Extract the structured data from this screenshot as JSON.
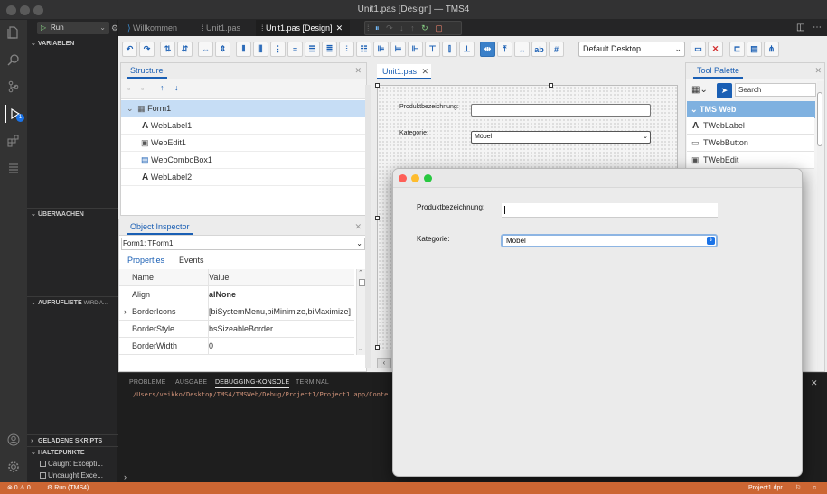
{
  "window": {
    "title": "Unit1.pas [Design] — TMS4"
  },
  "run": {
    "config": "Run"
  },
  "sidebar": {
    "variables": "VARIABLEN",
    "watch": "ÜBERWACHEN",
    "callstack": "AUFRUFLISTE",
    "callstack_status": "WIRD A...",
    "scripts": "GELADENE SKRIPTS",
    "breakpoints": "HALTEPUNKTE",
    "bp1": "Caught Excepti...",
    "bp2": "Uncaught Exce..."
  },
  "activity": {
    "debug_badge": "1"
  },
  "tabs": [
    {
      "label": "Willkommen"
    },
    {
      "label": "Unit1.pas"
    },
    {
      "label": "Unit1.pas [Design]"
    }
  ],
  "toolbar": {
    "device": "Default Desktop"
  },
  "structure": {
    "title": "Structure",
    "items": [
      {
        "label": "Form1",
        "icon": "form-icon"
      },
      {
        "label": "WebLabel1",
        "icon": "label-icon"
      },
      {
        "label": "WebEdit1",
        "icon": "edit-icon"
      },
      {
        "label": "WebComboBox1",
        "icon": "combobox-icon"
      },
      {
        "label": "WebLabel2",
        "icon": "label-icon"
      }
    ]
  },
  "inspector": {
    "title": "Object Inspector",
    "selected": "Form1: TForm1",
    "tab_properties": "Properties",
    "tab_events": "Events",
    "col_name": "Name",
    "col_value": "Value",
    "rows": [
      {
        "name": "Align",
        "value": "alNone",
        "expand": ""
      },
      {
        "name": "BorderIcons",
        "value": "[biSystemMenu,biMinimize,biMaximize]",
        "expand": "›"
      },
      {
        "name": "BorderStyle",
        "value": "bsSizeableBorder",
        "expand": ""
      },
      {
        "name": "BorderWidth",
        "value": "0",
        "expand": ""
      }
    ]
  },
  "designer": {
    "tab": "Unit1.pas",
    "label1": "Produktbezeichnung:",
    "label2": "Kategorie:",
    "combo_value": "Möbel"
  },
  "palette": {
    "title": "Tool Palette",
    "search_placeholder": "Search",
    "category": "TMS Web",
    "items": [
      "TWebLabel",
      "TWebButton",
      "TWebEdit"
    ]
  },
  "panel_tabs": {
    "problems": "PROBLEME",
    "output": "AUSGABE",
    "debug_console": "DEBUGGING-KONSOLE",
    "terminal": "TERMINAL"
  },
  "console": {
    "line": "/Users/veikko/Desktop/TMS4/TMSWeb/Debug/Project1/Project1.app/Conte",
    "prompt": "›"
  },
  "runwindow": {
    "label1": "Produktbezeichnung:",
    "label2": "Kategorie:",
    "combo_value": "Möbel"
  },
  "status": {
    "errors": "⊗ 0 ⚠ 0",
    "run": "Run (TMS4)",
    "project": "Project1.dpr"
  },
  "colors": {
    "accent": "#1a5fb4",
    "status": "#cc6633",
    "selected_row": "#c6ddf5"
  }
}
